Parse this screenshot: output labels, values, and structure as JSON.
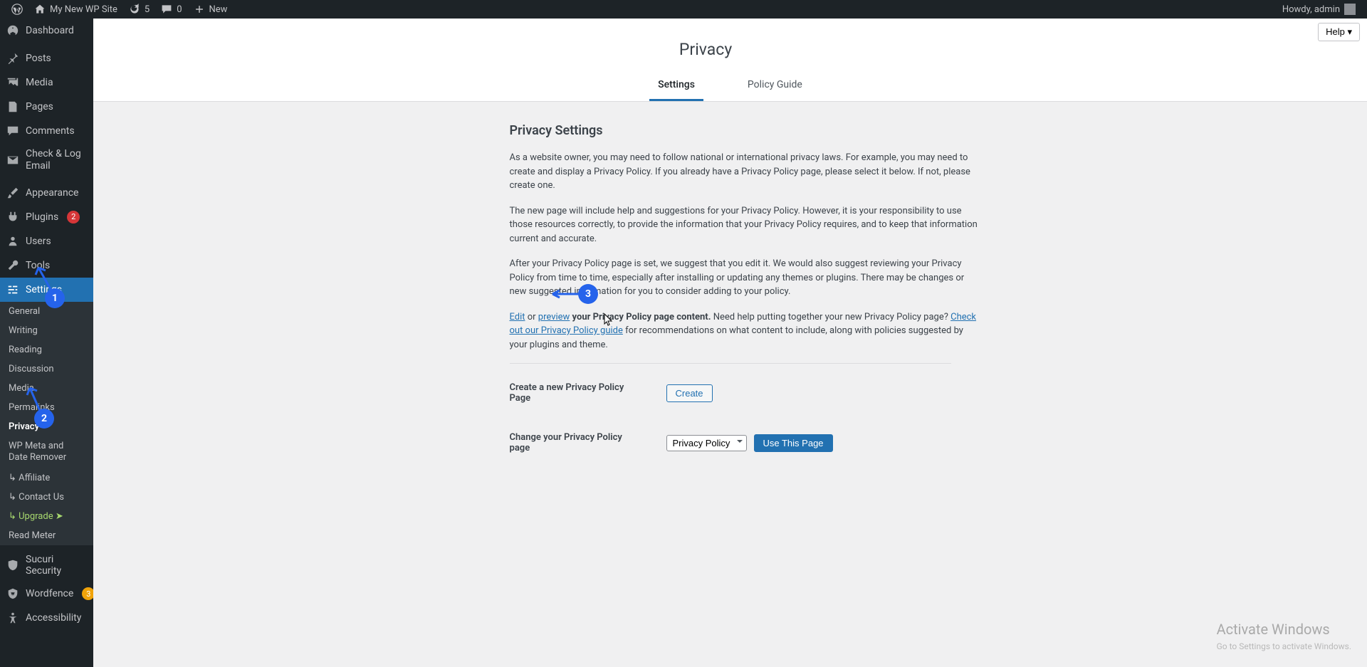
{
  "adminbar": {
    "site_name": "My New WP Site",
    "refresh_count": "5",
    "comments_count": "0",
    "new_label": "New",
    "howdy": "Howdy, admin"
  },
  "sidebar": {
    "items": [
      {
        "label": "Dashboard"
      },
      {
        "label": "Posts"
      },
      {
        "label": "Media"
      },
      {
        "label": "Pages"
      },
      {
        "label": "Comments"
      },
      {
        "label": "Check & Log Email"
      },
      {
        "label": "Appearance"
      },
      {
        "label": "Plugins",
        "badge": "2"
      },
      {
        "label": "Users"
      },
      {
        "label": "Tools"
      },
      {
        "label": "Settings"
      },
      {
        "label": "Sucuri Security"
      },
      {
        "label": "Wordfence",
        "badge": "3"
      },
      {
        "label": "Accessibility"
      }
    ],
    "submenu": [
      {
        "label": "General"
      },
      {
        "label": "Writing"
      },
      {
        "label": "Reading"
      },
      {
        "label": "Discussion"
      },
      {
        "label": "Media"
      },
      {
        "label": "Permalinks"
      },
      {
        "label": "Privacy"
      },
      {
        "label": "WP Meta and Date Remover"
      },
      {
        "label": "↳ Affiliate"
      },
      {
        "label": "↳ Contact Us"
      },
      {
        "label": "↳ Upgrade  ➤"
      },
      {
        "label": "Read Meter"
      }
    ]
  },
  "help_label": "Help ▾",
  "page_title": "Privacy",
  "tabs": {
    "settings": "Settings",
    "guide": "Policy Guide"
  },
  "section_title": "Privacy Settings",
  "paragraphs": {
    "p1": "As a website owner, you may need to follow national or international privacy laws. For example, you may need to create and display a Privacy Policy. If you already have a Privacy Policy page, please select it below. If not, please create one.",
    "p2": "The new page will include help and suggestions for your Privacy Policy. However, it is your responsibility to use those resources correctly, to provide the information that your Privacy Policy requires, and to keep that information current and accurate.",
    "p3": "After your Privacy Policy page is set, we suggest that you edit it. We would also suggest reviewing your Privacy Policy from time to time, especially after installing or updating any themes or plugins. There may be changes or new suggested information for you to consider adding to your policy.",
    "edit": "Edit",
    "or": " or ",
    "preview": "preview",
    "p4a": " your Privacy Policy page content.",
    "p4b": " Need help putting together your new Privacy Policy page? ",
    "checkout": "Check out our Privacy Policy guide",
    "p4c": " for recommendations on what content to include, along with policies suggested by your plugins and theme."
  },
  "form": {
    "create_label": "Create a new Privacy Policy Page",
    "create_btn": "Create",
    "change_label": "Change your Privacy Policy page",
    "select_value": "Privacy Policy",
    "use_btn": "Use This Page"
  },
  "annotations": {
    "b1": "1",
    "b2": "2",
    "b3": "3"
  },
  "watermark": {
    "title": "Activate Windows",
    "sub": "Go to Settings to activate Windows."
  }
}
